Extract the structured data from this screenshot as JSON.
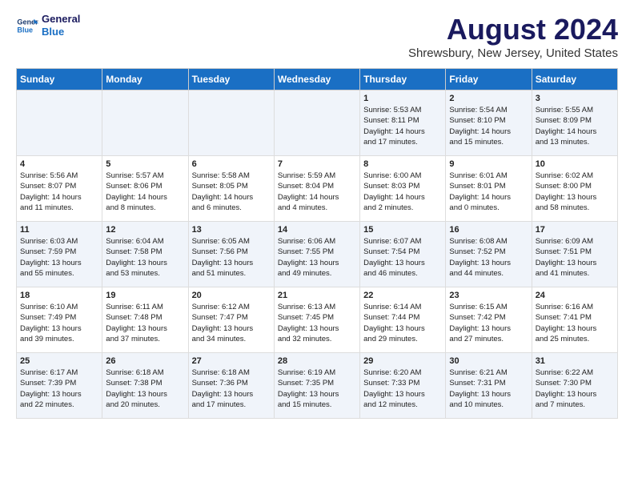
{
  "logo": {
    "line1": "General",
    "line2": "Blue"
  },
  "title": "August 2024",
  "subtitle": "Shrewsbury, New Jersey, United States",
  "days_of_week": [
    "Sunday",
    "Monday",
    "Tuesday",
    "Wednesday",
    "Thursday",
    "Friday",
    "Saturday"
  ],
  "weeks": [
    [
      {
        "day": "",
        "info": ""
      },
      {
        "day": "",
        "info": ""
      },
      {
        "day": "",
        "info": ""
      },
      {
        "day": "",
        "info": ""
      },
      {
        "day": "1",
        "info": "Sunrise: 5:53 AM\nSunset: 8:11 PM\nDaylight: 14 hours\nand 17 minutes."
      },
      {
        "day": "2",
        "info": "Sunrise: 5:54 AM\nSunset: 8:10 PM\nDaylight: 14 hours\nand 15 minutes."
      },
      {
        "day": "3",
        "info": "Sunrise: 5:55 AM\nSunset: 8:09 PM\nDaylight: 14 hours\nand 13 minutes."
      }
    ],
    [
      {
        "day": "4",
        "info": "Sunrise: 5:56 AM\nSunset: 8:07 PM\nDaylight: 14 hours\nand 11 minutes."
      },
      {
        "day": "5",
        "info": "Sunrise: 5:57 AM\nSunset: 8:06 PM\nDaylight: 14 hours\nand 8 minutes."
      },
      {
        "day": "6",
        "info": "Sunrise: 5:58 AM\nSunset: 8:05 PM\nDaylight: 14 hours\nand 6 minutes."
      },
      {
        "day": "7",
        "info": "Sunrise: 5:59 AM\nSunset: 8:04 PM\nDaylight: 14 hours\nand 4 minutes."
      },
      {
        "day": "8",
        "info": "Sunrise: 6:00 AM\nSunset: 8:03 PM\nDaylight: 14 hours\nand 2 minutes."
      },
      {
        "day": "9",
        "info": "Sunrise: 6:01 AM\nSunset: 8:01 PM\nDaylight: 14 hours\nand 0 minutes."
      },
      {
        "day": "10",
        "info": "Sunrise: 6:02 AM\nSunset: 8:00 PM\nDaylight: 13 hours\nand 58 minutes."
      }
    ],
    [
      {
        "day": "11",
        "info": "Sunrise: 6:03 AM\nSunset: 7:59 PM\nDaylight: 13 hours\nand 55 minutes."
      },
      {
        "day": "12",
        "info": "Sunrise: 6:04 AM\nSunset: 7:58 PM\nDaylight: 13 hours\nand 53 minutes."
      },
      {
        "day": "13",
        "info": "Sunrise: 6:05 AM\nSunset: 7:56 PM\nDaylight: 13 hours\nand 51 minutes."
      },
      {
        "day": "14",
        "info": "Sunrise: 6:06 AM\nSunset: 7:55 PM\nDaylight: 13 hours\nand 49 minutes."
      },
      {
        "day": "15",
        "info": "Sunrise: 6:07 AM\nSunset: 7:54 PM\nDaylight: 13 hours\nand 46 minutes."
      },
      {
        "day": "16",
        "info": "Sunrise: 6:08 AM\nSunset: 7:52 PM\nDaylight: 13 hours\nand 44 minutes."
      },
      {
        "day": "17",
        "info": "Sunrise: 6:09 AM\nSunset: 7:51 PM\nDaylight: 13 hours\nand 41 minutes."
      }
    ],
    [
      {
        "day": "18",
        "info": "Sunrise: 6:10 AM\nSunset: 7:49 PM\nDaylight: 13 hours\nand 39 minutes."
      },
      {
        "day": "19",
        "info": "Sunrise: 6:11 AM\nSunset: 7:48 PM\nDaylight: 13 hours\nand 37 minutes."
      },
      {
        "day": "20",
        "info": "Sunrise: 6:12 AM\nSunset: 7:47 PM\nDaylight: 13 hours\nand 34 minutes."
      },
      {
        "day": "21",
        "info": "Sunrise: 6:13 AM\nSunset: 7:45 PM\nDaylight: 13 hours\nand 32 minutes."
      },
      {
        "day": "22",
        "info": "Sunrise: 6:14 AM\nSunset: 7:44 PM\nDaylight: 13 hours\nand 29 minutes."
      },
      {
        "day": "23",
        "info": "Sunrise: 6:15 AM\nSunset: 7:42 PM\nDaylight: 13 hours\nand 27 minutes."
      },
      {
        "day": "24",
        "info": "Sunrise: 6:16 AM\nSunset: 7:41 PM\nDaylight: 13 hours\nand 25 minutes."
      }
    ],
    [
      {
        "day": "25",
        "info": "Sunrise: 6:17 AM\nSunset: 7:39 PM\nDaylight: 13 hours\nand 22 minutes."
      },
      {
        "day": "26",
        "info": "Sunrise: 6:18 AM\nSunset: 7:38 PM\nDaylight: 13 hours\nand 20 minutes."
      },
      {
        "day": "27",
        "info": "Sunrise: 6:18 AM\nSunset: 7:36 PM\nDaylight: 13 hours\nand 17 minutes."
      },
      {
        "day": "28",
        "info": "Sunrise: 6:19 AM\nSunset: 7:35 PM\nDaylight: 13 hours\nand 15 minutes."
      },
      {
        "day": "29",
        "info": "Sunrise: 6:20 AM\nSunset: 7:33 PM\nDaylight: 13 hours\nand 12 minutes."
      },
      {
        "day": "30",
        "info": "Sunrise: 6:21 AM\nSunset: 7:31 PM\nDaylight: 13 hours\nand 10 minutes."
      },
      {
        "day": "31",
        "info": "Sunrise: 6:22 AM\nSunset: 7:30 PM\nDaylight: 13 hours\nand 7 minutes."
      }
    ]
  ]
}
